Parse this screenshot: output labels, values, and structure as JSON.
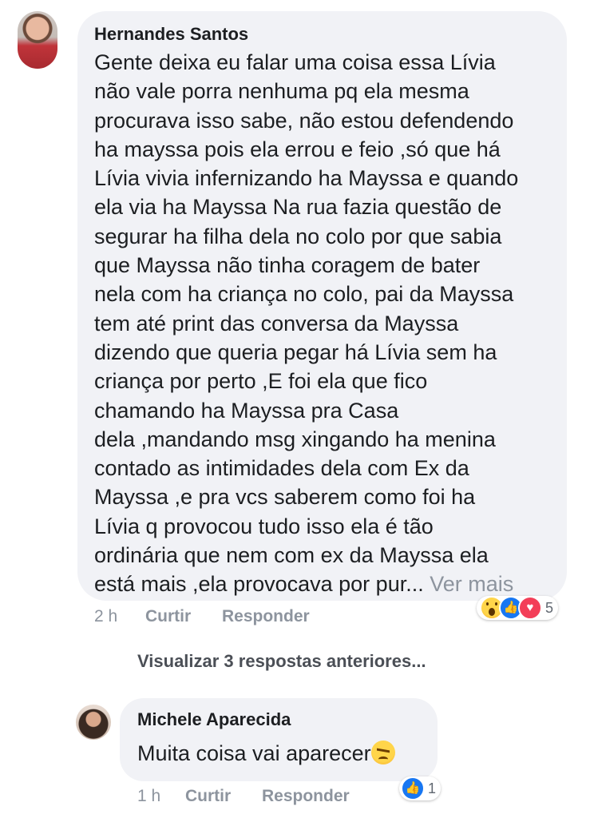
{
  "comment": {
    "author": "Hernandes Santos",
    "lines": [
      "Gente deixa eu falar uma coisa essa Lívia",
      "não vale porra  nenhuma pq ela mesma",
      "procurava isso sabe, não estou defendendo",
      "ha mayssa pois ela errou e feio ,só que há",
      "Lívia vivia infernizando ha Mayssa e quando",
      "ela via ha Mayssa Na rua fazia questão de",
      "segurar ha filha dela no colo por que sabia",
      "que Mayssa não tinha coragem de bater",
      "nela com ha criança no colo, pai da Mayssa",
      "tem até print das conversa da Mayssa",
      "dizendo que queria pegar há Lívia sem ha",
      "criança por perto ,E foi ela que fico",
      "chamando ha Mayssa  pra Casa",
      "dela ,mandando msg xingando ha menina",
      "contado as intimidades dela com Ex da",
      "Mayssa ,e pra vcs saberem como foi ha",
      "Lívia q provocou tudo isso ela é tão",
      "ordinária que nem com ex da Mayssa ela"
    ],
    "last_line": "está mais ,ela provocava por pur...",
    "see_more": "Ver mais",
    "time": "2 h",
    "like_action": "Curtir",
    "reply_action": "Responder",
    "reactions": {
      "icons": [
        "wow-icon",
        "like-icon",
        "love-icon"
      ],
      "count": "5"
    }
  },
  "previous_replies": "Visualizar 3 respostas anteriores...",
  "reply": {
    "author": "Michele Aparecida",
    "text": "Muita coisa vai aparecer",
    "emoji": "angry-face-icon",
    "time": "1 h",
    "like_action": "Curtir",
    "reply_action": "Responder",
    "reactions": {
      "icons": [
        "like-icon"
      ],
      "count": "1"
    }
  },
  "colors": {
    "bubble": "#f1f2f6",
    "text": "#1c1e21",
    "meta": "#8d949e",
    "like_blue": "#1877f2",
    "love_red": "#f33e58"
  }
}
